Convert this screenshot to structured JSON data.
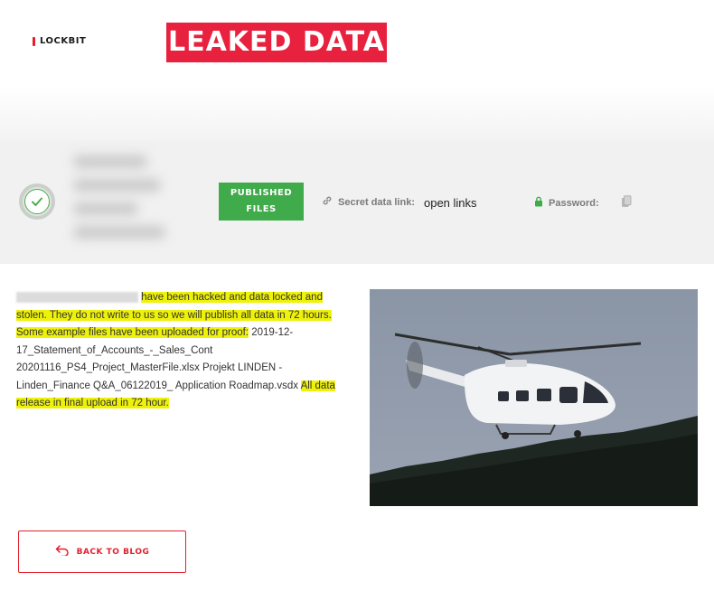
{
  "header": {
    "logo_text": "LOCKBIT",
    "banner_title": "LEAKED DATA"
  },
  "victim": {
    "status_icon": "check-icon",
    "badge_line1": "PUBLISHED",
    "badge_line2": "FILES",
    "secret_label": "Secret data link:",
    "secret_value": "open links",
    "password_label": "Password:"
  },
  "description": {
    "part1": "have been hacked and data locked and stolen. They do not write to us so we will publish all data in 72 hours. Some example files have been uploaded for proof:",
    "files": "2019-12-17_Statement_of_Accounts_-_Sales_Cont 20201116_PS4_Project_MasterFile.xlsx Projekt LINDEN - Linden_Finance Q&A_06122019_ Application Roadmap.vsdx",
    "part2": "All data release in final upload in 72 hour."
  },
  "actions": {
    "back_label": "BACK TO BLOG"
  },
  "colors": {
    "brand_red": "#e8213f",
    "badge_green": "#3fab4a",
    "highlight": "#eef10a"
  }
}
